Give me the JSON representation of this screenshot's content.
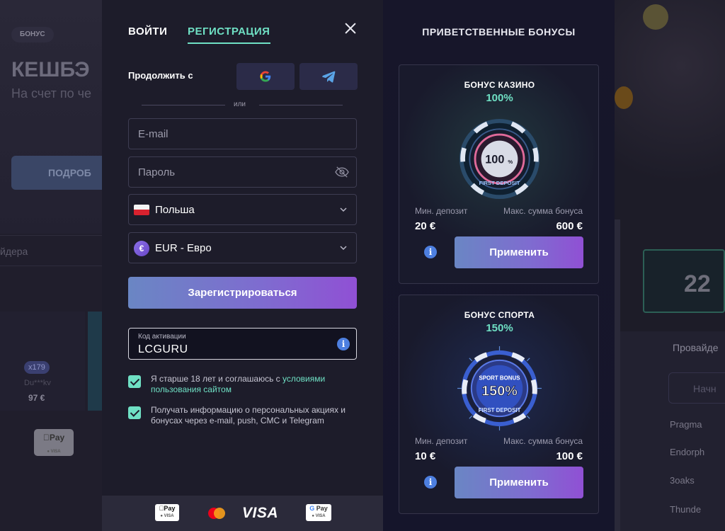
{
  "background": {
    "badge": "БОНУС",
    "hero_title": "КЕШБЭ",
    "hero_subtitle": "На счет по че",
    "more_button": "ПОДРОБ",
    "search_text": "йдера",
    "multiplier": "x179",
    "username": "Du***kv",
    "amount": "97 €",
    "applepay": "Pay",
    "jackpot": "22",
    "providers_title": "Провайде",
    "providers_search": "Начн",
    "providers": [
      "Pragma",
      "Endorph",
      "3oaks",
      "Thunde"
    ]
  },
  "auth": {
    "tabs": {
      "login": "ВОЙТИ",
      "register": "РЕГИСТРАЦИЯ"
    },
    "continue_with": "Продолжить с",
    "or": "или",
    "email_placeholder": "E-mail",
    "password_placeholder": "Пароль",
    "country": "Польша",
    "currency": "EUR - Евро",
    "currency_symbol": "€",
    "register_button": "Зарегистрироваться",
    "activation_code_label": "Код активации",
    "activation_code_value": "LCGURU",
    "consent_age_text": "Я старше 18 лет и соглашаюсь с ",
    "consent_age_link": "условиями пользования сайтом",
    "consent_marketing": "Получать информацию о персональных акциях и бонусах через e-mail, push, СМС и Telegram"
  },
  "payments": {
    "applepay": "Pay",
    "visa": "VISA",
    "gpay": "Pay"
  },
  "bonuses": {
    "title": "ПРИВЕТСТВЕННЫЕ БОНУСЫ",
    "cards": [
      {
        "name": "БОНУС КАЗИНО",
        "percent": "100%",
        "chip_text": "100",
        "chip_sub": "FIRST DEPOSIT",
        "min_label": "Мин. депозит",
        "max_label": "Макс. сумма бонуса",
        "min_value": "20 €",
        "max_value": "600 €",
        "apply": "Применить"
      },
      {
        "name": "БОНУС СПОРТА",
        "percent": "150%",
        "chip_text": "150%",
        "chip_sub": "FIRST DEPOSIT",
        "chip_top": "SPORT BONUS",
        "min_label": "Мин. депозит",
        "max_label": "Макс. сумма бонуса",
        "min_value": "10 €",
        "max_value": "100 €",
        "apply": "Применить"
      }
    ]
  },
  "colors": {
    "accent": "#6fe0c4",
    "button_gradient_start": "#6a86c4",
    "button_gradient_end": "#9050d4",
    "info": "#4d7fe0"
  }
}
